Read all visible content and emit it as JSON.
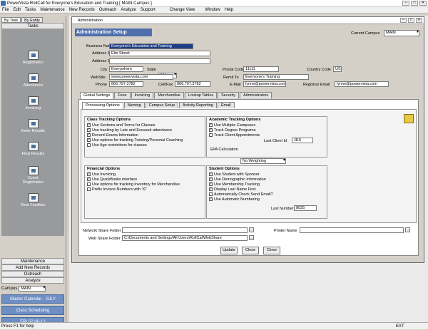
{
  "app": {
    "title": "PowerVista RollCall for Everyone's Education and Training     [ MAIN Campus ]",
    "menu": [
      "File",
      "Edit",
      "Tasks",
      "Maintenance",
      "New Records",
      "Outreach",
      "Analyze",
      "Support",
      "Change View",
      "Window",
      "Help"
    ]
  },
  "sidebar": {
    "tabs": [
      "By Task",
      "By Entity"
    ],
    "header": "Tasks",
    "icons": [
      "Registration",
      "Attendance",
      "Invoicing",
      "Enter Results",
      "Final Results",
      "Event Registration",
      "Rent Facilities"
    ],
    "groups": [
      "Maintenance",
      "Add New Records",
      "Outreach",
      "Analyze"
    ],
    "campus_label": "Campus",
    "campus_value": "MAIN",
    "buttons": [
      "Master Calendar - JULY",
      "Class Scheduling",
      "FRI 07-06-12"
    ]
  },
  "status": {
    "left": "Press F1 for help",
    "right": "EXT"
  },
  "window": {
    "title": "Administration",
    "header": "Administration Setup",
    "current_campus_label": "Current Campus",
    "current_campus_value": "MAIN",
    "fields": {
      "business_name_label": "Business Name",
      "business_name": "Everyone's Education and Training",
      "address1_label": "Address 1",
      "address1": "Elm Street",
      "address2_label": "Address 2",
      "address2": "",
      "city_label": "City",
      "city": "Everywhere",
      "state_label": "State",
      "state": "NY",
      "postal_label": "Postal Code",
      "postal": "11111",
      "country_label": "Country Code",
      "country": "US",
      "website_label": "WebSite",
      "website": "www.powervista.com",
      "remit_label": "Remit To",
      "remit": "Everyone's Training",
      "phone_label": "Phone",
      "phone": "866.797.3782",
      "cellfax_label": "Cell/Fax",
      "cellfax": "866.797.3782",
      "email_label": "E-Mail",
      "email": "lynne@powervista.com",
      "regemail_label": "Registrar Email",
      "regemail": "lynne@powervista.com"
    },
    "tabs": [
      "Global Settings",
      "Fees",
      "Invoicing",
      "Merchandise",
      "Lookup Tables",
      "Security",
      "Administrators"
    ],
    "subtabs": [
      "Processing Options",
      "Naming",
      "Campus Setup",
      "Activity Reporting",
      "Email"
    ],
    "class_tracking": {
      "title": "Class Tracking Options",
      "items": [
        {
          "label": "Use Sections and Terms for Classes",
          "checked": true
        },
        {
          "label": "Use tracking by Late and Excused attendance",
          "checked": true
        },
        {
          "label": "Record Exams Information",
          "checked": true
        },
        {
          "label": "Use options for tracking Tutoring/Personal Coaching",
          "checked": true
        },
        {
          "label": "Use Age restrictions for classes",
          "checked": false
        }
      ]
    },
    "academic_tracking": {
      "title": "Academic Tracking Options",
      "items": [
        {
          "label": "Use Multiple Campuses",
          "checked": true
        },
        {
          "label": "Track Degree Programs",
          "checked": true
        },
        {
          "label": "Track Client Appointments",
          "checked": false
        }
      ],
      "last_client_label": "Last Client Id",
      "last_client_value": "JKS",
      "gpa_label": "GPA Calculation",
      "gpa_value": "No Weighting"
    },
    "financial": {
      "title": "Financial Options",
      "items": [
        {
          "label": "Use Invoicing",
          "checked": true
        },
        {
          "label": "Use QuickBooks interface",
          "checked": true
        },
        {
          "label": "Use options for tracking Inventory for Merchandise",
          "checked": false
        },
        {
          "label": "Prefix Invoice Numbers with 'IC'",
          "checked": false
        }
      ]
    },
    "student": {
      "title": "Student Options",
      "items": [
        {
          "label": "Use Student with Sponsor",
          "checked": true
        },
        {
          "label": "Use Demographic information",
          "checked": true
        },
        {
          "label": "Use Membership Tracking",
          "checked": true
        },
        {
          "label": "Display Last Name First",
          "checked": true
        },
        {
          "label": "Automatically Check Send Email?",
          "checked": false
        },
        {
          "label": "Use Automatic Numbering",
          "checked": true
        }
      ],
      "last_number_label": "Last Number",
      "last_number_value": "8025"
    },
    "network_share_label": "Network Share Folder",
    "network_share_value": "",
    "printer_label": "Printer Name",
    "printer_value": "",
    "web_share_label": "Web Share Folder",
    "web_share_value": "C:\\Documents and Settings\\All Users\\RollCallWebShare",
    "buttons": {
      "update": "Update",
      "close_small": "Close",
      "close": "Close"
    }
  }
}
